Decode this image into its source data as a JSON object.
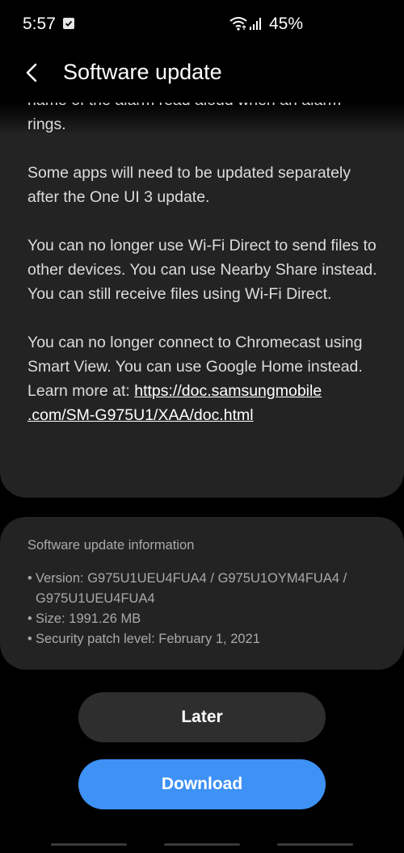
{
  "status_bar": {
    "time": "5:57",
    "battery": "45%"
  },
  "header": {
    "title": "Software update"
  },
  "notes": {
    "partial_line": "name of the alarm read aloud when an alarm",
    "ringing_tail": "rings.",
    "apps_note": "Some apps will need to be updated separately after the One UI 3 update.",
    "wifi_direct_note": "You can no longer use Wi-Fi Direct to send files to other devices. You can use Nearby Share instead. You can still receive files using Wi-Fi Direct.",
    "chromecast_note": "You can no longer connect to Chromecast using Smart View. You can use Google Home instead.",
    "learn_more_prefix": "Learn more at: ",
    "learn_more_link_part1": "https://doc.samsungmobile",
    "learn_more_link_part2": ".com/SM-G975U1/XAA/doc.html"
  },
  "info": {
    "title": "Software update information",
    "version": "Version: G975U1UEU4FUA4 / G975U1OYM4FUA4 / G975U1UEU4FUA4",
    "size": "Size: 1991.26 MB",
    "security_patch": "Security patch level: February 1, 2021"
  },
  "buttons": {
    "later": "Later",
    "download": "Download"
  },
  "colors": {
    "accent": "#3e91f5",
    "card": "#232323",
    "background": "#000000"
  }
}
